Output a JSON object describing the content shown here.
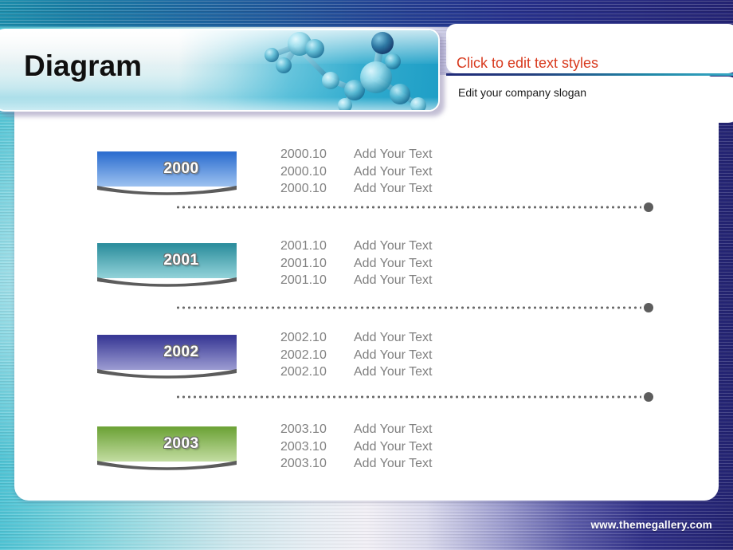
{
  "slide": {
    "title": "Diagram",
    "edit_title": "Click to edit text styles",
    "slogan": "Edit your company slogan",
    "footer_url": "www.themegallery.com"
  },
  "colors": {
    "title_text": "#101010",
    "edit_title_red": "#d83a1e",
    "entry_gray": "#808080",
    "separator_dot": "#5d5d5d",
    "band_teal": "#1d8fae",
    "band_navy": "#242374"
  },
  "rows": [
    {
      "year": "2000",
      "banner_top": "#2f6fd0",
      "banner_bottom": "#9dc2f0",
      "entries": [
        {
          "date": "2000.10",
          "text": "Add Your Text"
        },
        {
          "date": "2000.10",
          "text": "Add Your Text"
        },
        {
          "date": "2000.10",
          "text": "Add Your Text"
        }
      ]
    },
    {
      "year": "2001",
      "banner_top": "#2e8f9e",
      "banner_bottom": "#93d3d9",
      "entries": [
        {
          "date": "2001.10",
          "text": "Add Your Text"
        },
        {
          "date": "2001.10",
          "text": "Add Your Text"
        },
        {
          "date": "2001.10",
          "text": "Add Your Text"
        }
      ]
    },
    {
      "year": "2002",
      "banner_top": "#3a3a96",
      "banner_bottom": "#9c9cd2",
      "entries": [
        {
          "date": "2002.10",
          "text": "Add Your Text"
        },
        {
          "date": "2002.10",
          "text": "Add Your Text"
        },
        {
          "date": "2002.10",
          "text": "Add Your Text"
        }
      ]
    },
    {
      "year": "2003",
      "banner_top": "#6fa43a",
      "banner_bottom": "#c3dda2",
      "entries": [
        {
          "date": "2003.10",
          "text": "Add Your Text"
        },
        {
          "date": "2003.10",
          "text": "Add Your Text"
        },
        {
          "date": "2003.10",
          "text": "Add Your Text"
        }
      ]
    }
  ],
  "separators": [
    {
      "index": 1
    },
    {
      "index": 2
    },
    {
      "index": 3
    }
  ]
}
